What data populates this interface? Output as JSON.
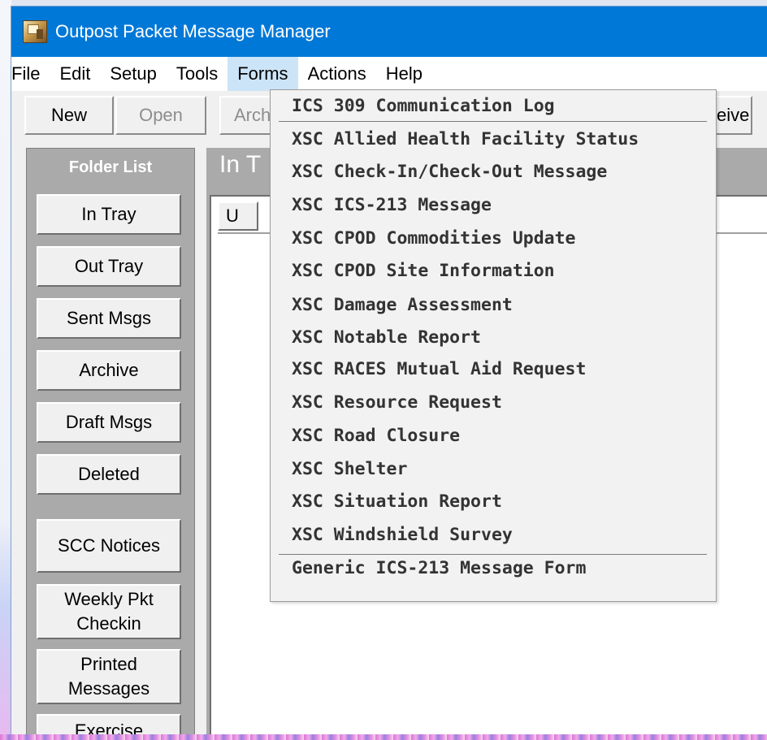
{
  "window": {
    "title": "Outpost Packet Message Manager",
    "icon": "app-icon"
  },
  "menubar": [
    "File",
    "Edit",
    "Setup",
    "Tools",
    "Forms",
    "Actions",
    "Help"
  ],
  "toolbar": {
    "new_label": "New",
    "open_label": "Open",
    "archive_label": "Arch",
    "receive_label": "eive"
  },
  "folder_list": {
    "title": "Folder List",
    "items": [
      "In Tray",
      "Out Tray",
      "Sent Msgs",
      "Archive",
      "Draft Msgs",
      "Deleted",
      "SCC Notices",
      "Weekly Pkt Checkin",
      "Printed Messages",
      "Exercise"
    ]
  },
  "content": {
    "title": "In T",
    "column_header": "U"
  },
  "forms_menu": {
    "items": [
      "ICS 309 Communication Log",
      "XSC Allied Health Facility Status",
      "XSC Check-In/Check-Out Message",
      "XSC ICS-213 Message",
      "XSC CPOD Commodities Update",
      "XSC CPOD Site Information",
      "XSC Damage Assessment",
      "XSC Notable Report",
      "XSC RACES Mutual Aid Request",
      "XSC Resource Request",
      "XSC Road Closure",
      "XSC Shelter",
      "XSC Situation Report",
      "XSC Windshield Survey",
      "Generic ICS-213 Message Form"
    ]
  },
  "colors": {
    "titlebar": "#0078d7",
    "menu_highlight": "#cce4f7",
    "panel_gray": "#aaaaaa"
  }
}
